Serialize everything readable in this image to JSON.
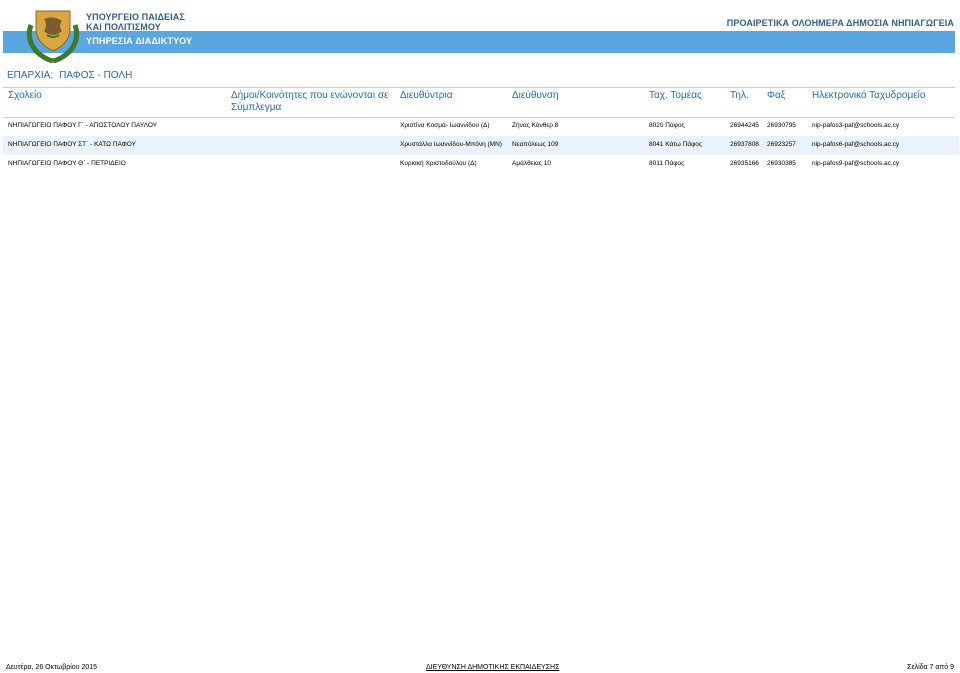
{
  "header": {
    "ministry_line1": "ΥΠΟΥΡΓΕΙΟ ΠΑΙΔΕΙΑΣ",
    "ministry_line2": "ΚΑΙ ΠΟΛΙΤΙΣΜΟΥ",
    "service": "ΥΠΗΡΕΣΙΑ ΔΙΑΔΙΚΤΥΟΥ",
    "program": "ΠΡΟΑΙΡΕΤΙΚΑ ΟΛΟΗΜΕΡΑ ΔΗΜΟΣΙΑ ΝΗΠΙΑΓΩΓΕΙΑ",
    "band_color": "#5aa6e0",
    "logo": "cyprus-coat-of-arms-icon"
  },
  "district": {
    "label": "ΕΠΑΡΧΙΑ:",
    "value": "ΠΑΦΟΣ - ΠΟΛΗ"
  },
  "table": {
    "headers": {
      "school": "Σχολείο",
      "communities_line1": "Δήμοι/Κοινότητες που ενώνονται σε",
      "communities_line2": "Σύμπλεγμα",
      "principal": "Διευθύντρια",
      "address": "Διεύθυνση",
      "postal": "Ταχ. Τομέας",
      "phone": "Τηλ.",
      "fax": "Φαξ",
      "email": "Ηλεκτρονικό Ταχυδρομείο"
    },
    "rows": [
      {
        "school": "ΝΗΠΙΑΓΩΓΕΙΟ ΠΑΦΟΥ Γ΄ - ΑΠΟΣΤΟΛΟΥ ΠΑΥΛΟΥ",
        "communities": "",
        "principal": "Χριστίνα Κοσμά- Ιωαννίδου (Δ)",
        "address": "Ζήνας Κάνθερ 8",
        "postal": "8020 Πάφος",
        "phone": "26944245",
        "fax": "26930795",
        "email": "nip-pafos3-paf@schools.ac.cy"
      },
      {
        "school": "ΝΗΠΙΑΓΩΓΕΙΟ ΠΑΦΟΥ ΣΤ΄ - ΚΑΤΩ ΠΑΦΟΥ",
        "communities": "",
        "principal": "Χρυστάλλα Ιωαννίδου-Μπόνη (ΜΝ)",
        "address": "Νεαπόλεως 109",
        "postal": "8041 Κάτω Πάφος",
        "phone": "26937808",
        "fax": "26923257",
        "email": "nip-pafos6-paf@schools.ac.cy"
      },
      {
        "school": "ΝΗΠΙΑΓΩΓΕΙΟ ΠΑΦΟΥ Θ΄ - ΠΕΤΡΙΔΕΙΟ",
        "communities": "",
        "principal": "Κυριακή Χριστοδούλου (Δ)",
        "address": "Αμάλθειας 10",
        "postal": "8011 Πάφος",
        "phone": "26935166",
        "fax": "26930385",
        "email": "nip-pafos9-paf@schools.ac.cy"
      }
    ]
  },
  "footer": {
    "date": "Δευτέρα, 26 Οκτωβρίου 2015",
    "department": "ΔΙΕΥΘΥΝΣΗ ΔΗΜΟΤΙΚΗΣ ΕΚΠΑΙΔΕΥΣΗΣ",
    "page": "Σελίδα 7 από 9"
  }
}
